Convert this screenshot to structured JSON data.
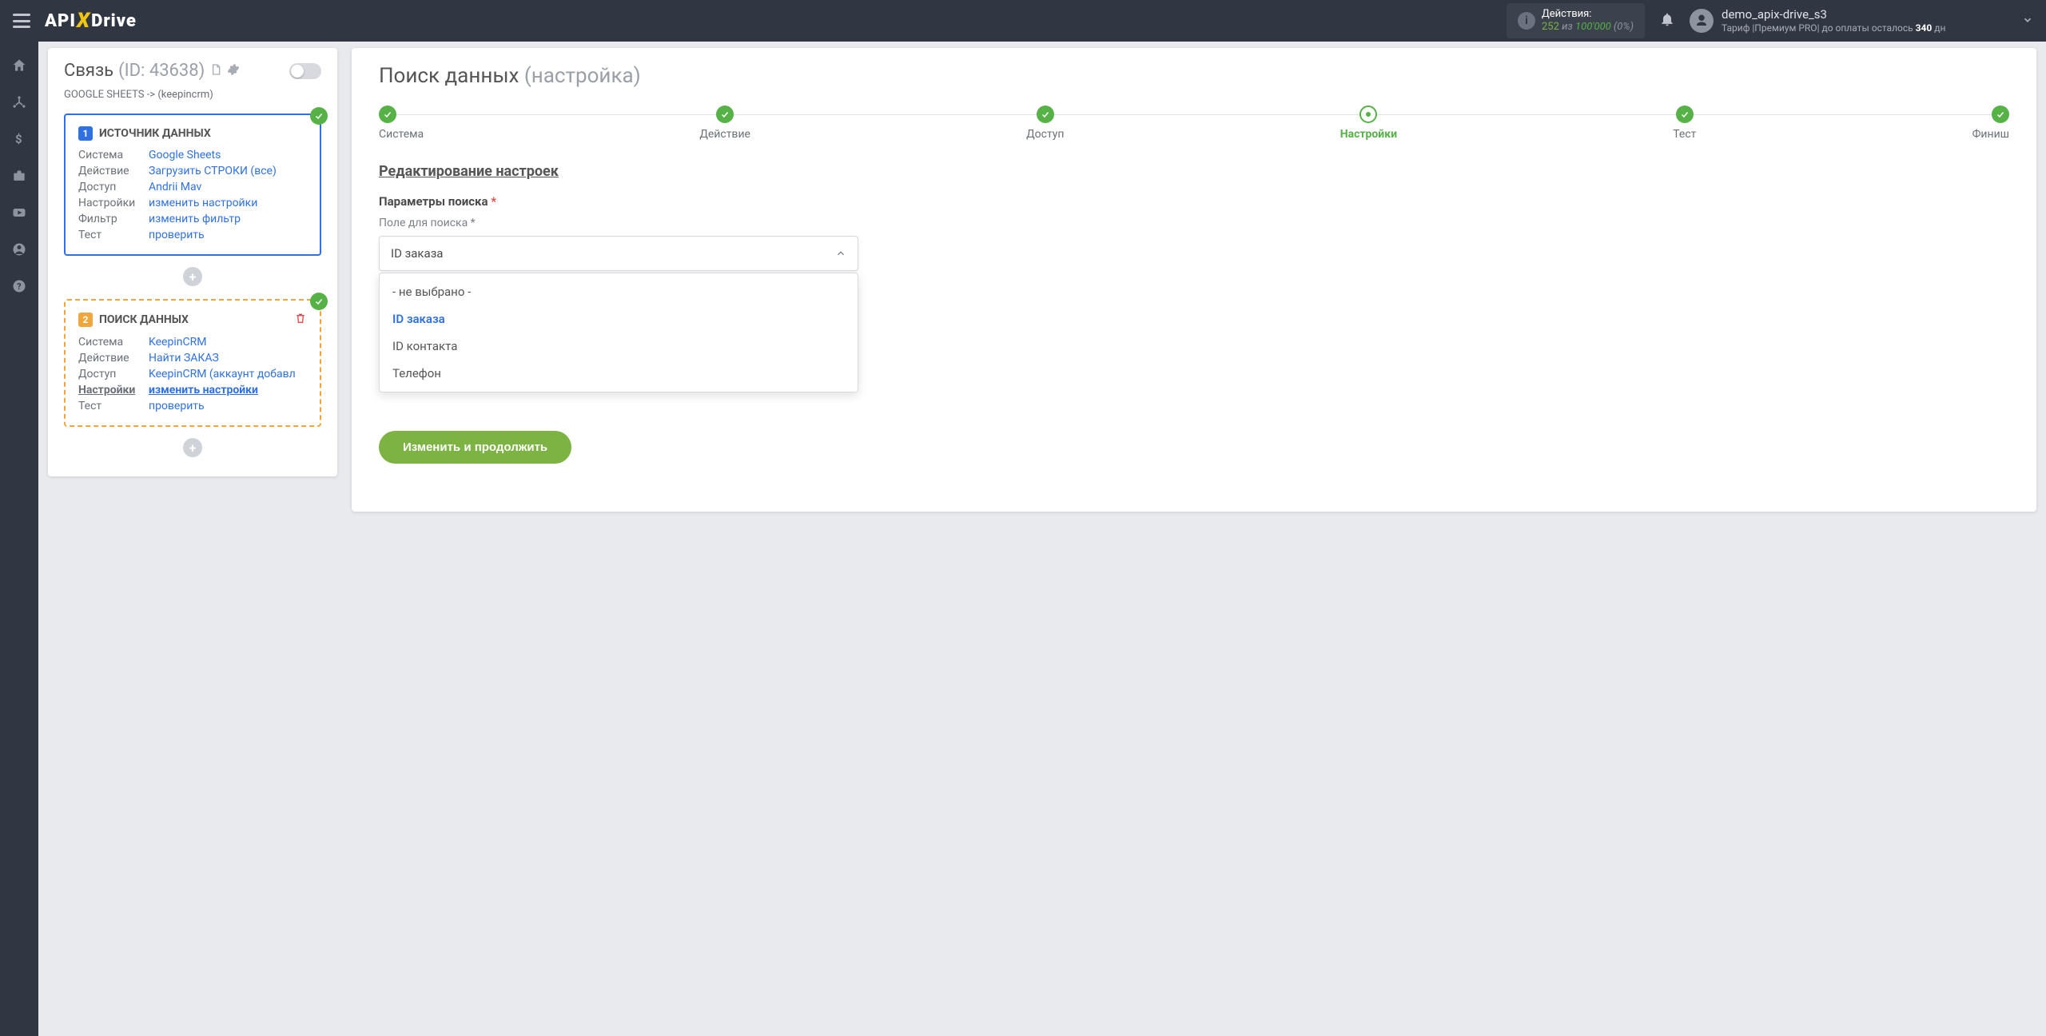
{
  "topbar": {
    "logo_left": "API",
    "logo_right": "Drive",
    "actions_label": "Действия:",
    "actions_count": "252",
    "actions_of": "из",
    "actions_total": "100'000",
    "actions_pct": "(0%)",
    "user_name": "demo_apix-drive_s3",
    "tariff_prefix": "Тариф |Премиум PRO|  до оплаты осталось ",
    "tariff_days": "340",
    "tariff_days_suffix": " дн"
  },
  "left": {
    "title": "Связь",
    "id_label": "(ID: 43638)",
    "sub": "GOOGLE SHEETS -> (keepincrm)",
    "panel1": {
      "num": "1",
      "title": "ИСТОЧНИК ДАННЫХ",
      "rows": {
        "system_k": "Система",
        "system_v": "Google Sheets",
        "action_k": "Действие",
        "action_v": "Загрузить СТРОКИ (все)",
        "access_k": "Доступ",
        "access_v": "Andrii Mav",
        "settings_k": "Настройки",
        "settings_v": "изменить настройки",
        "filter_k": "Фильтр",
        "filter_v": "изменить фильтр",
        "test_k": "Тест",
        "test_v": "проверить"
      }
    },
    "panel2": {
      "num": "2",
      "title": "ПОИСК ДАННЫХ",
      "rows": {
        "system_k": "Система",
        "system_v": "KeepinCRM",
        "action_k": "Действие",
        "action_v": "Найти ЗАКАЗ",
        "access_k": "Доступ",
        "access_v": "KeepinCRM (аккаунт добавл",
        "settings_k": "Настройки",
        "settings_v": "изменить настройки",
        "test_k": "Тест",
        "test_v": "проверить"
      }
    }
  },
  "right": {
    "title_main": "Поиск данных",
    "title_sub": "(настройка)",
    "steps": [
      "Система",
      "Действие",
      "Доступ",
      "Настройки",
      "Тест",
      "Финиш"
    ],
    "section": "Редактирование настроек",
    "params_label": "Параметры поиска",
    "field_label": "Поле для поиска *",
    "select": {
      "value": "ID заказа",
      "options": [
        "- не выбрано -",
        "ID заказа",
        "ID контакта",
        "Телефон"
      ]
    },
    "submit": "Изменить и продолжить"
  }
}
